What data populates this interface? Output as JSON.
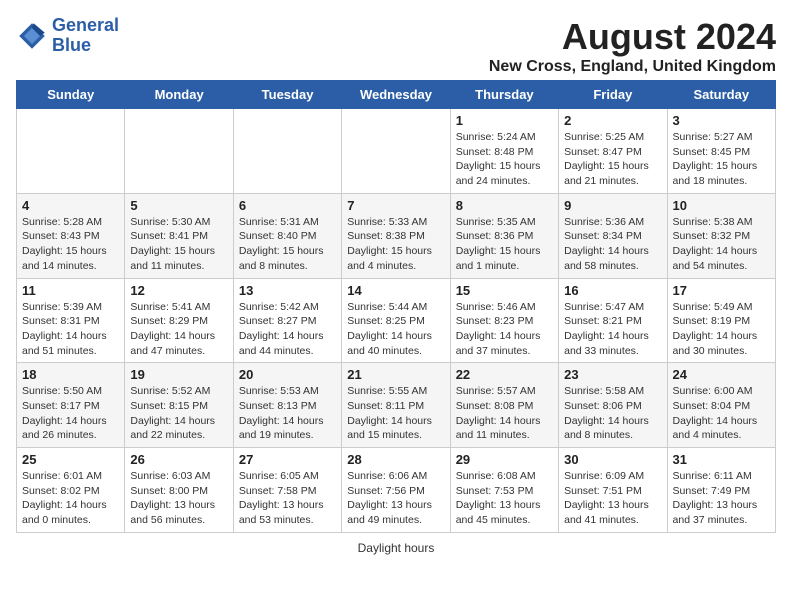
{
  "header": {
    "logo_line1": "General",
    "logo_line2": "Blue",
    "title": "August 2024",
    "subtitle": "New Cross, England, United Kingdom"
  },
  "days_of_week": [
    "Sunday",
    "Monday",
    "Tuesday",
    "Wednesday",
    "Thursday",
    "Friday",
    "Saturday"
  ],
  "weeks": [
    [
      {
        "day": "",
        "info": ""
      },
      {
        "day": "",
        "info": ""
      },
      {
        "day": "",
        "info": ""
      },
      {
        "day": "",
        "info": ""
      },
      {
        "day": "1",
        "info": "Sunrise: 5:24 AM\nSunset: 8:48 PM\nDaylight: 15 hours\nand 24 minutes."
      },
      {
        "day": "2",
        "info": "Sunrise: 5:25 AM\nSunset: 8:47 PM\nDaylight: 15 hours\nand 21 minutes."
      },
      {
        "day": "3",
        "info": "Sunrise: 5:27 AM\nSunset: 8:45 PM\nDaylight: 15 hours\nand 18 minutes."
      }
    ],
    [
      {
        "day": "4",
        "info": "Sunrise: 5:28 AM\nSunset: 8:43 PM\nDaylight: 15 hours\nand 14 minutes."
      },
      {
        "day": "5",
        "info": "Sunrise: 5:30 AM\nSunset: 8:41 PM\nDaylight: 15 hours\nand 11 minutes."
      },
      {
        "day": "6",
        "info": "Sunrise: 5:31 AM\nSunset: 8:40 PM\nDaylight: 15 hours\nand 8 minutes."
      },
      {
        "day": "7",
        "info": "Sunrise: 5:33 AM\nSunset: 8:38 PM\nDaylight: 15 hours\nand 4 minutes."
      },
      {
        "day": "8",
        "info": "Sunrise: 5:35 AM\nSunset: 8:36 PM\nDaylight: 15 hours\nand 1 minute."
      },
      {
        "day": "9",
        "info": "Sunrise: 5:36 AM\nSunset: 8:34 PM\nDaylight: 14 hours\nand 58 minutes."
      },
      {
        "day": "10",
        "info": "Sunrise: 5:38 AM\nSunset: 8:32 PM\nDaylight: 14 hours\nand 54 minutes."
      }
    ],
    [
      {
        "day": "11",
        "info": "Sunrise: 5:39 AM\nSunset: 8:31 PM\nDaylight: 14 hours\nand 51 minutes."
      },
      {
        "day": "12",
        "info": "Sunrise: 5:41 AM\nSunset: 8:29 PM\nDaylight: 14 hours\nand 47 minutes."
      },
      {
        "day": "13",
        "info": "Sunrise: 5:42 AM\nSunset: 8:27 PM\nDaylight: 14 hours\nand 44 minutes."
      },
      {
        "day": "14",
        "info": "Sunrise: 5:44 AM\nSunset: 8:25 PM\nDaylight: 14 hours\nand 40 minutes."
      },
      {
        "day": "15",
        "info": "Sunrise: 5:46 AM\nSunset: 8:23 PM\nDaylight: 14 hours\nand 37 minutes."
      },
      {
        "day": "16",
        "info": "Sunrise: 5:47 AM\nSunset: 8:21 PM\nDaylight: 14 hours\nand 33 minutes."
      },
      {
        "day": "17",
        "info": "Sunrise: 5:49 AM\nSunset: 8:19 PM\nDaylight: 14 hours\nand 30 minutes."
      }
    ],
    [
      {
        "day": "18",
        "info": "Sunrise: 5:50 AM\nSunset: 8:17 PM\nDaylight: 14 hours\nand 26 minutes."
      },
      {
        "day": "19",
        "info": "Sunrise: 5:52 AM\nSunset: 8:15 PM\nDaylight: 14 hours\nand 22 minutes."
      },
      {
        "day": "20",
        "info": "Sunrise: 5:53 AM\nSunset: 8:13 PM\nDaylight: 14 hours\nand 19 minutes."
      },
      {
        "day": "21",
        "info": "Sunrise: 5:55 AM\nSunset: 8:11 PM\nDaylight: 14 hours\nand 15 minutes."
      },
      {
        "day": "22",
        "info": "Sunrise: 5:57 AM\nSunset: 8:08 PM\nDaylight: 14 hours\nand 11 minutes."
      },
      {
        "day": "23",
        "info": "Sunrise: 5:58 AM\nSunset: 8:06 PM\nDaylight: 14 hours\nand 8 minutes."
      },
      {
        "day": "24",
        "info": "Sunrise: 6:00 AM\nSunset: 8:04 PM\nDaylight: 14 hours\nand 4 minutes."
      }
    ],
    [
      {
        "day": "25",
        "info": "Sunrise: 6:01 AM\nSunset: 8:02 PM\nDaylight: 14 hours\nand 0 minutes."
      },
      {
        "day": "26",
        "info": "Sunrise: 6:03 AM\nSunset: 8:00 PM\nDaylight: 13 hours\nand 56 minutes."
      },
      {
        "day": "27",
        "info": "Sunrise: 6:05 AM\nSunset: 7:58 PM\nDaylight: 13 hours\nand 53 minutes."
      },
      {
        "day": "28",
        "info": "Sunrise: 6:06 AM\nSunset: 7:56 PM\nDaylight: 13 hours\nand 49 minutes."
      },
      {
        "day": "29",
        "info": "Sunrise: 6:08 AM\nSunset: 7:53 PM\nDaylight: 13 hours\nand 45 minutes."
      },
      {
        "day": "30",
        "info": "Sunrise: 6:09 AM\nSunset: 7:51 PM\nDaylight: 13 hours\nand 41 minutes."
      },
      {
        "day": "31",
        "info": "Sunrise: 6:11 AM\nSunset: 7:49 PM\nDaylight: 13 hours\nand 37 minutes."
      }
    ]
  ],
  "footer": {
    "note": "Daylight hours"
  }
}
